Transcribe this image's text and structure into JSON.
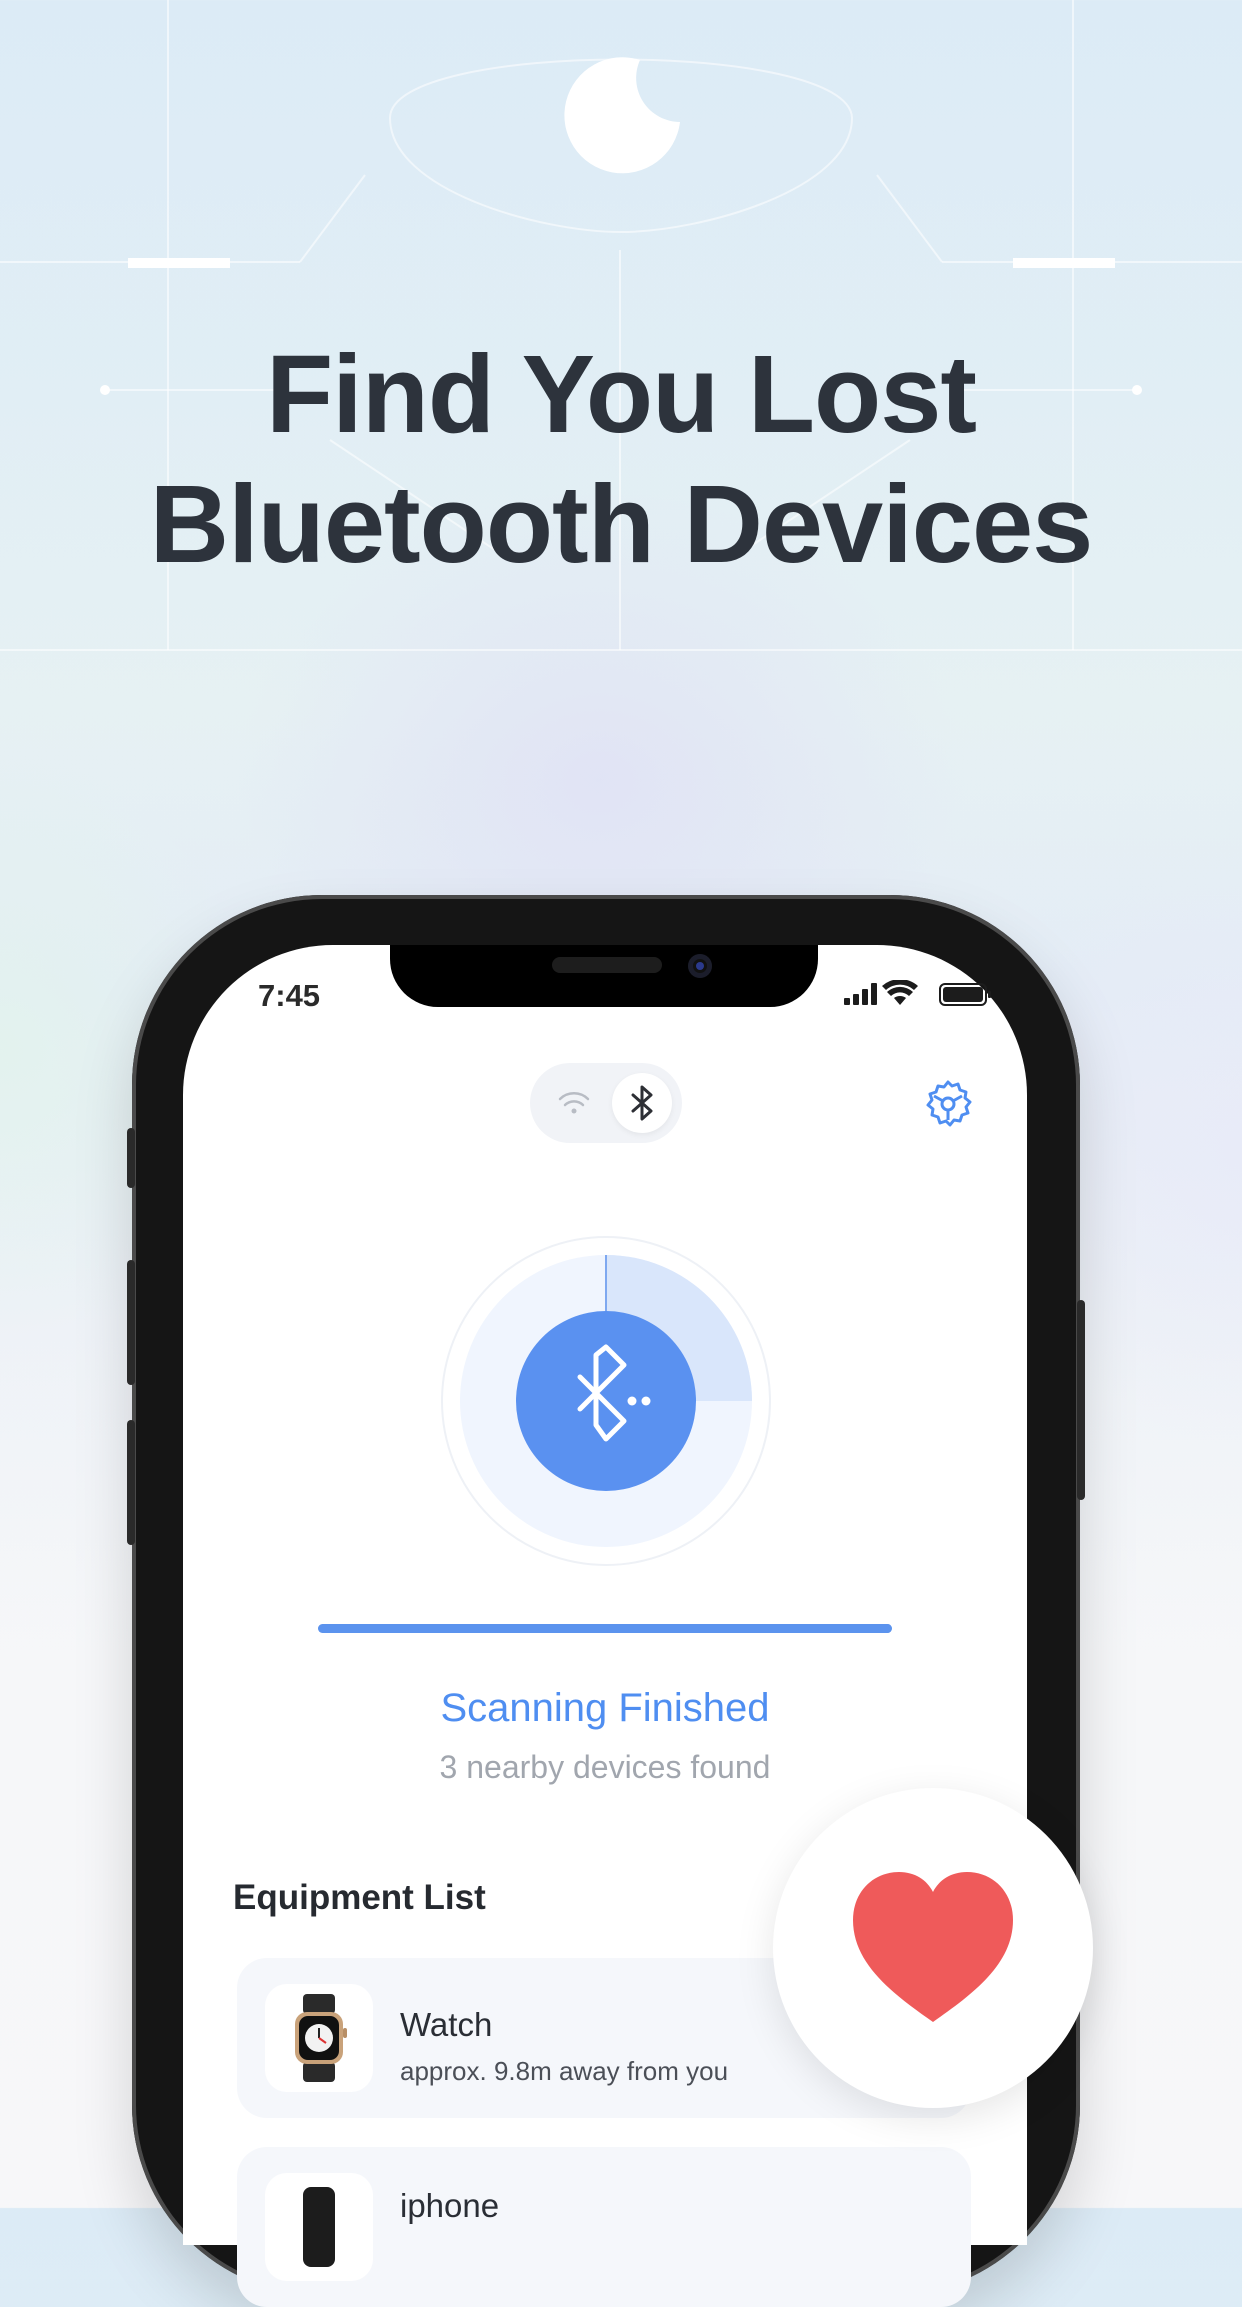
{
  "headline": {
    "line1": "Find You Lost",
    "line2": "Bluetooth Devices"
  },
  "status_bar": {
    "time": "7:45"
  },
  "toggle": {
    "options": [
      "wifi-icon",
      "bluetooth-icon"
    ],
    "selected": "bluetooth-icon"
  },
  "scan": {
    "progress": 1.0,
    "radial_progress": 0.25,
    "title": "Scanning Finished",
    "subtitle": "3 nearby devices found"
  },
  "equipment": {
    "title": "Equipment List",
    "devices": [
      {
        "name": "Watch",
        "distance": "approx. 9.8m away from you",
        "icon": "watch-icon"
      },
      {
        "name": "iphone",
        "distance": "",
        "icon": "phone-icon"
      }
    ]
  },
  "favorite": {
    "icon": "heart-icon",
    "color": "#ef5a5a"
  },
  "colors": {
    "accent": "#5b93ee",
    "headline": "#2d333c"
  }
}
